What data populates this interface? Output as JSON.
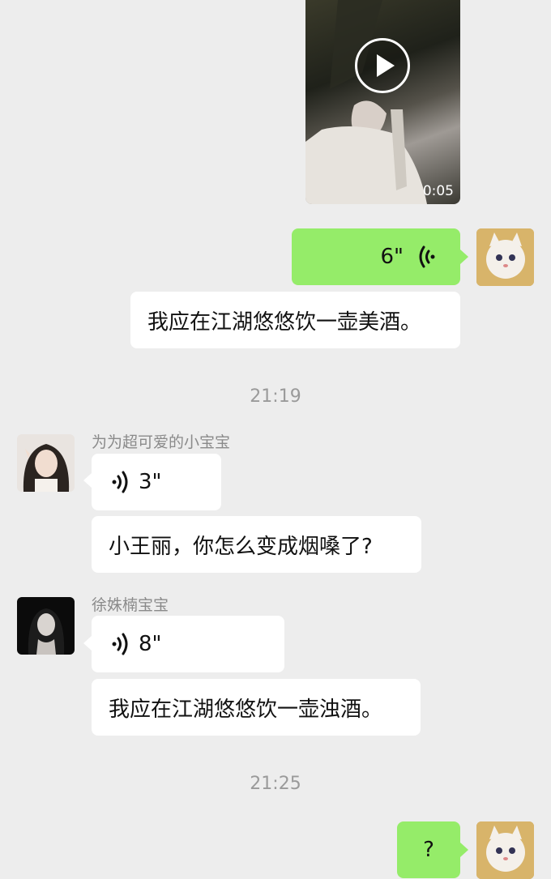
{
  "video": {
    "duration": "0:05"
  },
  "messages": {
    "m1_voice_duration": "6\"",
    "m2_text": "我应在江湖悠悠饮一壶美酒。",
    "time1": "21:19",
    "sender1": "为为超可爱的小宝宝",
    "m3_voice_duration": "3\"",
    "m4_text": "小王丽，你怎么变成烟嗓了?",
    "sender2": "徐姝楠宝宝",
    "m5_voice_duration": "8\"",
    "m6_text": "我应在江湖悠悠饮一壶浊酒。",
    "time2": "21:25",
    "m7_text": "?"
  },
  "colors": {
    "background": "#ededed",
    "bubble_self": "#95ec69",
    "bubble_other": "#ffffff",
    "timestamp": "#9a9a9a"
  }
}
